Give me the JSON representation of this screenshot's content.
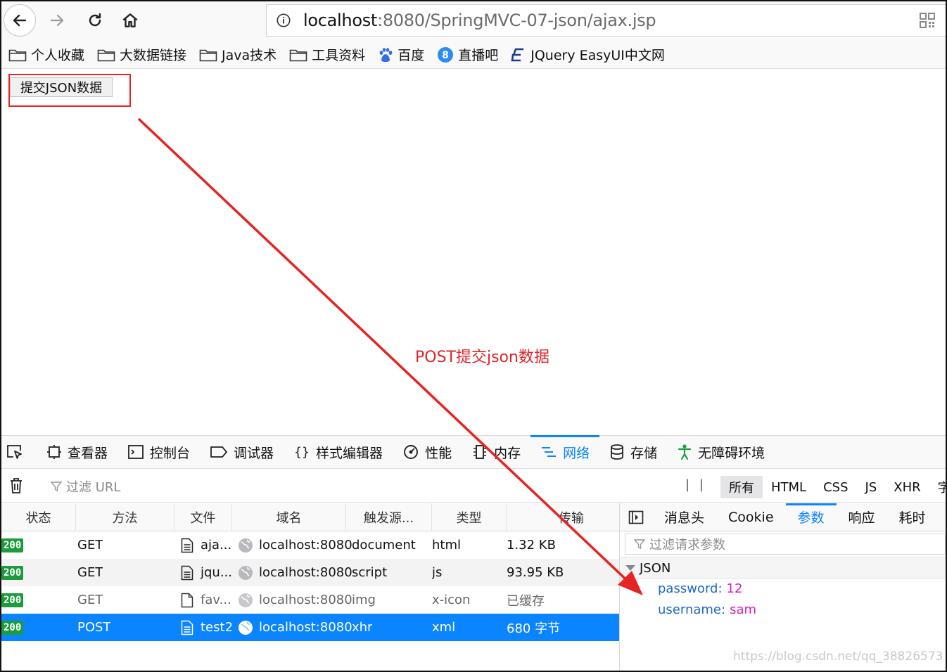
{
  "browser": {
    "url_host": "localhost",
    "url_rest": ":8080/SpringMVC-07-json/ajax.jsp",
    "bookmarks": [
      {
        "label": "个人收藏",
        "icon": "folder-icon"
      },
      {
        "label": "大数据链接",
        "icon": "folder-icon"
      },
      {
        "label": "Java技术",
        "icon": "folder-icon"
      },
      {
        "label": "工具资料",
        "icon": "folder-icon"
      },
      {
        "label": "百度",
        "icon": "baidu-paw-icon"
      },
      {
        "label": "直播吧",
        "icon": "zhibo8-icon"
      },
      {
        "label": "JQuery EasyUI中文网",
        "icon": "easyui-icon"
      }
    ]
  },
  "page": {
    "submit_button": "提交JSON数据",
    "annotation": "POST提交json数据",
    "annotation_color": "#e0242a"
  },
  "devtools": {
    "tabs": [
      {
        "label": "查看器",
        "icon": "inspector-icon"
      },
      {
        "label": "控制台",
        "icon": "console-icon"
      },
      {
        "label": "调试器",
        "icon": "debugger-icon"
      },
      {
        "label": "样式编辑器",
        "icon": "style-editor-icon"
      },
      {
        "label": "性能",
        "icon": "performance-icon"
      },
      {
        "label": "内存",
        "icon": "memory-icon"
      },
      {
        "label": "网络",
        "icon": "network-icon"
      },
      {
        "label": "存储",
        "icon": "storage-icon"
      },
      {
        "label": "无障碍环境",
        "icon": "accessibility-icon"
      }
    ],
    "active_tab": "网络",
    "filter_placeholder": "过滤 URL",
    "pause_label": "| |",
    "type_filters": [
      "所有",
      "HTML",
      "CSS",
      "JS",
      "XHR",
      "字"
    ],
    "columns": [
      "状态",
      "方法",
      "文件",
      "域名",
      "触发源...",
      "类型",
      "传输"
    ],
    "requests": [
      {
        "status": "200",
        "method": "GET",
        "file": "aja...",
        "domain": "localhost:8080",
        "cause": "document",
        "type": "html",
        "transfer": "1.32 KB"
      },
      {
        "status": "200",
        "method": "GET",
        "file": "jqu...",
        "domain": "localhost:8080",
        "cause": "script",
        "type": "js",
        "transfer": "93.95 KB"
      },
      {
        "status": "200",
        "method": "GET",
        "file": "fav...",
        "domain": "localhost:8080",
        "cause": "img",
        "type": "x-icon",
        "transfer": "已缓存"
      },
      {
        "status": "200",
        "method": "POST",
        "file": "test2",
        "domain": "localhost:8080",
        "cause": "xhr",
        "type": "xml",
        "transfer": "680 字节"
      }
    ],
    "side_tabs": [
      "消息头",
      "Cookie",
      "参数",
      "响应",
      "耗时"
    ],
    "side_active": "参数",
    "param_filter_placeholder": "过滤请求参数",
    "json_section": "JSON",
    "params": [
      {
        "key": "password:",
        "value": "12"
      },
      {
        "key": "username:",
        "value": "sam"
      }
    ],
    "watermark": "https://blog.csdn.net/qq_38826573"
  }
}
